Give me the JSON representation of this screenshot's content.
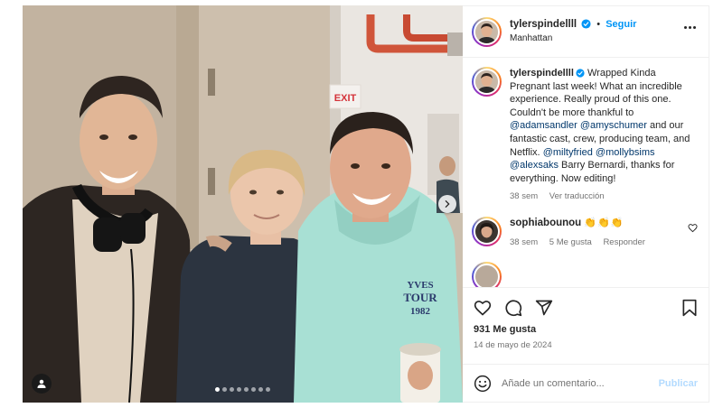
{
  "post": {
    "username": "tylerspindellll",
    "follow_label": "Seguir",
    "separator": "•",
    "location": "Manhattan",
    "more_icon": "more-horizontal-icon",
    "photo": {
      "carousel_count": 8,
      "active_index": 0,
      "shirt_text_line1": "YVES",
      "shirt_text_line2": "TOUR",
      "shirt_text_line3": "1982",
      "exit_sign": "EXIT"
    },
    "caption": {
      "username": "tylerspindellll",
      "segments": [
        {
          "text": " Wrapped Kinda Pregnant last week! What an incredible experience. Really proud of this one. Couldn't be more thankful to ",
          "mention": false
        },
        {
          "text": "@adamsandler",
          "mention": true
        },
        {
          "text": " ",
          "mention": false
        },
        {
          "text": "@amyschumer",
          "mention": true
        },
        {
          "text": " and our fantastic cast, crew, producing team, and Netflix. ",
          "mention": false
        },
        {
          "text": "@miltyfried",
          "mention": true
        },
        {
          "text": " ",
          "mention": false
        },
        {
          "text": "@mollybsims",
          "mention": true
        },
        {
          "text": " ",
          "mention": false
        },
        {
          "text": "@alexsaks",
          "mention": true
        },
        {
          "text": " Barry Bernardi, thanks for everything. Now editing!",
          "mention": false
        }
      ],
      "time": "38 sem",
      "translate": "Ver traducción"
    },
    "comments": [
      {
        "username": "sophiabounou",
        "text": "👏👏👏",
        "time": "38 sem",
        "likes": "5 Me gusta",
        "reply": "Responder"
      }
    ],
    "likes_text": "931 Me gusta",
    "date_text": "14 de mayo de 2024",
    "comment_placeholder": "Añade un comentario...",
    "publish_label": "Publicar"
  },
  "colors": {
    "accent": "#0095f6",
    "mention": "#00376b",
    "muted": "#737373",
    "publish_disabled": "#b3dbff"
  }
}
